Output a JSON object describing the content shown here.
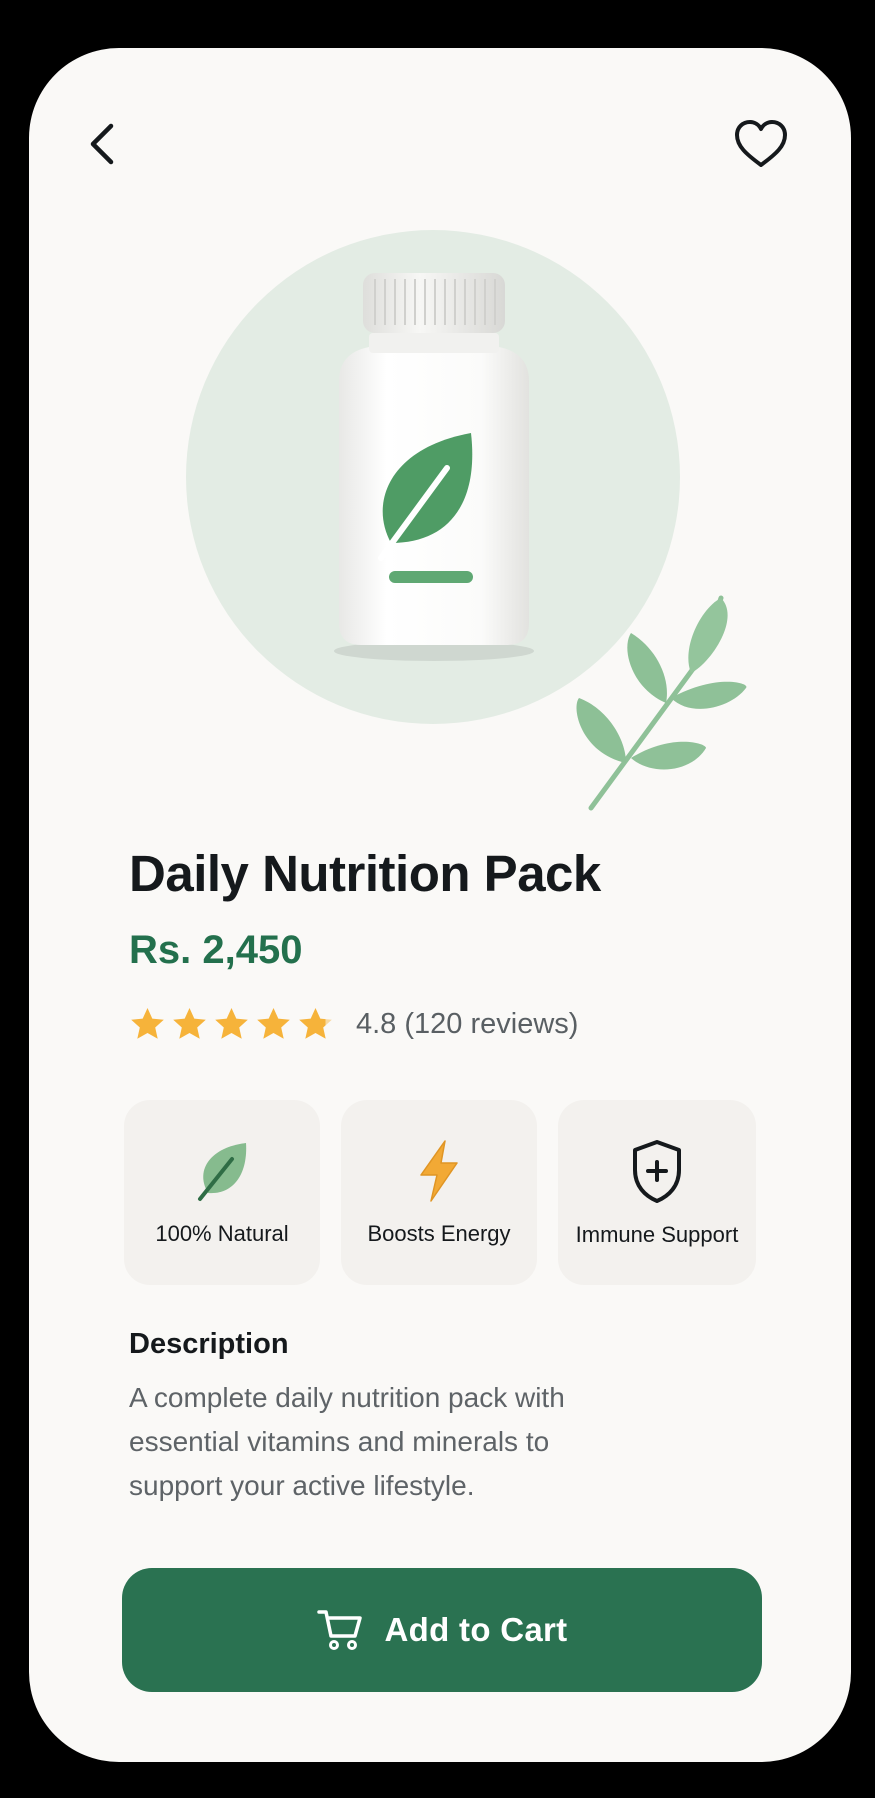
{
  "header": {
    "back_icon": "chevron-left-icon",
    "favorite_icon": "heart-outline-icon"
  },
  "product": {
    "name": "Daily Nutrition Pack",
    "price": "Rs. 2,450",
    "rating": {
      "value": 4.8,
      "max": 5,
      "text": "4.8 (120 reviews)"
    },
    "image_icon": "supplement-bottle-icon"
  },
  "features": [
    {
      "label": "100% Natural",
      "icon": "leaf-icon"
    },
    {
      "label": "Boosts Energy",
      "icon": "lightning-icon"
    },
    {
      "label": "Immune Support",
      "icon": "shield-plus-icon"
    }
  ],
  "description": {
    "heading": "Description",
    "body": "A complete daily nutrition pack with essential vitamins and minerals to support your active lifestyle."
  },
  "cart_button": {
    "label": "Add to Cart",
    "icon": "cart-icon"
  },
  "colors": {
    "accent": "#2a7251",
    "price": "#23704d",
    "star": "#f6b33a",
    "leaf": "#7fb889",
    "hero_circle": "#e3ece4",
    "background": "#faf9f7"
  }
}
